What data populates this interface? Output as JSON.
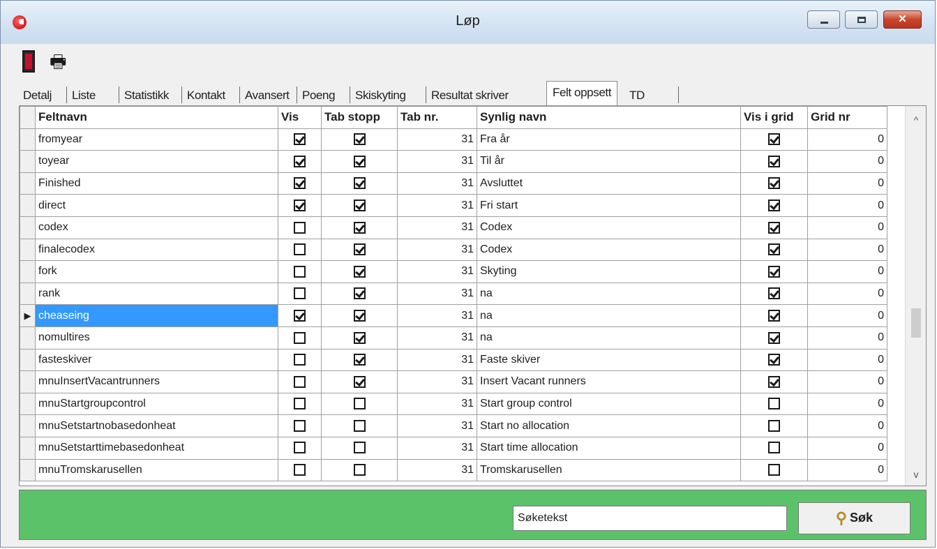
{
  "window": {
    "title": "Løp",
    "minimize_glyph": "",
    "maximize_glyph": "",
    "close_glyph": "✕"
  },
  "toolbar": {
    "printer_glyph": "🖶"
  },
  "tabs": [
    "Detalj",
    "Liste",
    "Statistikk",
    "Kontakt",
    "Avansert",
    "Poeng",
    "Skiskyting",
    "Resultat skriver",
    "Felt oppsett",
    "TD"
  ],
  "active_tab": "Felt oppsett",
  "grid": {
    "columns": [
      "",
      "Feltnavn",
      "Vis",
      "Tab stopp",
      "Tab nr.",
      "Synlig navn",
      "Vis i grid",
      "Grid nr"
    ],
    "current_row_marker": "▶",
    "rows": [
      {
        "feltnavn": "fromyear",
        "vis": true,
        "tab_stopp": true,
        "tab_nr": "31",
        "synlig_navn": "Fra år",
        "vis_i_grid": true,
        "grid_nr": "0"
      },
      {
        "feltnavn": "toyear",
        "vis": true,
        "tab_stopp": true,
        "tab_nr": "31",
        "synlig_navn": "Til år",
        "vis_i_grid": true,
        "grid_nr": "0"
      },
      {
        "feltnavn": "Finished",
        "vis": true,
        "tab_stopp": true,
        "tab_nr": "31",
        "synlig_navn": "Avsluttet",
        "vis_i_grid": true,
        "grid_nr": "0"
      },
      {
        "feltnavn": "direct",
        "vis": true,
        "tab_stopp": true,
        "tab_nr": "31",
        "synlig_navn": "Fri start",
        "vis_i_grid": true,
        "grid_nr": "0"
      },
      {
        "feltnavn": "codex",
        "vis": false,
        "tab_stopp": true,
        "tab_nr": "31",
        "synlig_navn": "Codex",
        "vis_i_grid": true,
        "grid_nr": "0"
      },
      {
        "feltnavn": "finalecodex",
        "vis": false,
        "tab_stopp": true,
        "tab_nr": "31",
        "synlig_navn": "Codex",
        "vis_i_grid": true,
        "grid_nr": "0"
      },
      {
        "feltnavn": "fork",
        "vis": false,
        "tab_stopp": true,
        "tab_nr": "31",
        "synlig_navn": "Skyting",
        "vis_i_grid": true,
        "grid_nr": "0"
      },
      {
        "feltnavn": "rank",
        "vis": false,
        "tab_stopp": true,
        "tab_nr": "31",
        "synlig_navn": "na",
        "vis_i_grid": true,
        "grid_nr": "0"
      },
      {
        "feltnavn": "cheaseing",
        "vis": true,
        "tab_stopp": true,
        "tab_nr": "31",
        "synlig_navn": "na",
        "vis_i_grid": true,
        "grid_nr": "0",
        "selected": true
      },
      {
        "feltnavn": "nomultires",
        "vis": false,
        "tab_stopp": true,
        "tab_nr": "31",
        "synlig_navn": "na",
        "vis_i_grid": true,
        "grid_nr": "0"
      },
      {
        "feltnavn": "fasteskiver",
        "vis": false,
        "tab_stopp": true,
        "tab_nr": "31",
        "synlig_navn": "Faste skiver",
        "vis_i_grid": true,
        "grid_nr": "0"
      },
      {
        "feltnavn": "mnuInsertVacantrunners",
        "vis": false,
        "tab_stopp": true,
        "tab_nr": "31",
        "synlig_navn": "Insert Vacant runners",
        "vis_i_grid": true,
        "grid_nr": "0"
      },
      {
        "feltnavn": "mnuStartgroupcontrol",
        "vis": false,
        "tab_stopp": false,
        "tab_nr": "31",
        "synlig_navn": "Start group control",
        "vis_i_grid": false,
        "grid_nr": "0"
      },
      {
        "feltnavn": "mnuSetstartnobasedonheat",
        "vis": false,
        "tab_stopp": false,
        "tab_nr": "31",
        "synlig_navn": "Start no allocation",
        "vis_i_grid": false,
        "grid_nr": "0"
      },
      {
        "feltnavn": "mnuSetstarttimebasedonheat",
        "vis": false,
        "tab_stopp": false,
        "tab_nr": "31",
        "synlig_navn": "Start time allocation",
        "vis_i_grid": false,
        "grid_nr": "0"
      },
      {
        "feltnavn": "mnuTromskarusellen",
        "vis": false,
        "tab_stopp": false,
        "tab_nr": "31",
        "synlig_navn": "Tromskarusellen",
        "vis_i_grid": false,
        "grid_nr": "0"
      }
    ],
    "scroll_up_glyph": "^",
    "scroll_down_glyph": "v"
  },
  "search": {
    "value": "Søketekst",
    "button_label": "Søk",
    "button_glyph": "⚲"
  },
  "colors": {
    "footer": "#5cc26a",
    "selection": "#3399ff",
    "close_button": "#c9462c"
  }
}
